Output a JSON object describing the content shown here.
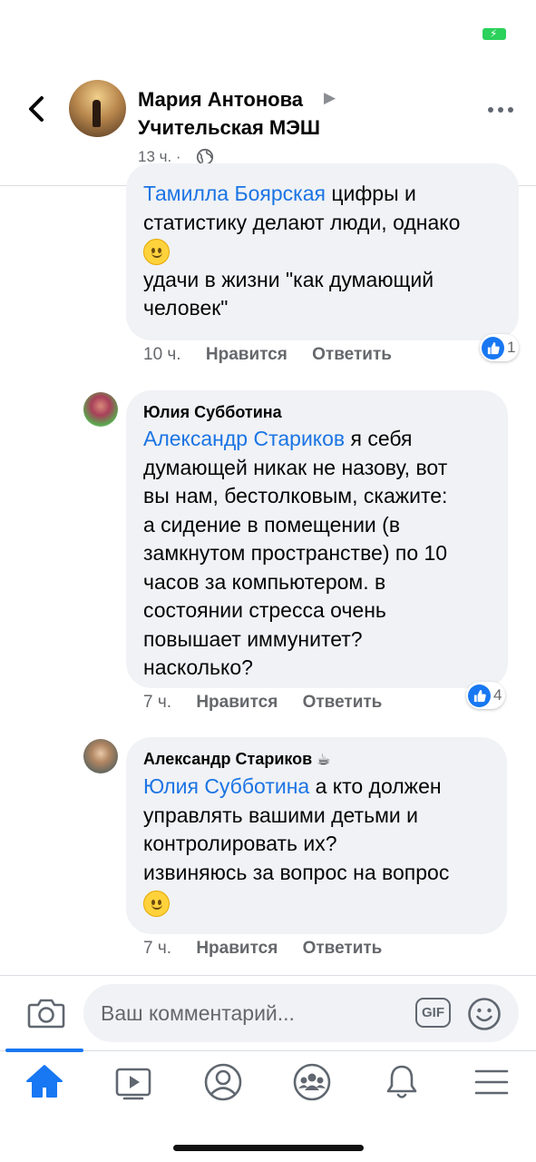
{
  "status_bar": {
    "battery_color": "#2bd15a",
    "icon": "charging-battery-icon"
  },
  "header": {
    "author": "Мария Антонова",
    "group": "Учительская МЭШ",
    "time": "13 ч. ·",
    "icons": [
      "back-chevron-icon",
      "globe-icon",
      "more-dots-icon",
      "triangle-right-icon"
    ]
  },
  "comments": [
    {
      "mention": "Тамилла Боярская",
      "line1": " цифры и",
      "line2": "статистику делают люди, однако",
      "line3": "удачи в  жизни \"как думающий",
      "line4": "человек\"",
      "time": "10 ч.",
      "like": "Нравится",
      "reply": "Ответить",
      "reactions": "1"
    },
    {
      "author": "Юлия Субботина",
      "mention": "Александр Стариков",
      "line1": " я себя",
      "line2": "думающей никак не назову, вот",
      "line3": "вы нам, бестолковым,  скажите:",
      "line4": "а сидение в помещении (в",
      "line5": "замкнутом пространстве) по 10",
      "line6": "часов за компьютером.  в",
      "line7": "состоянии стресса очень",
      "line8": "повышает иммунитет?",
      "line9": "насколько?",
      "time": "7 ч.",
      "like": "Нравится",
      "reply": "Ответить",
      "reactions": "4"
    },
    {
      "author": "Александр Стариков",
      "author_badge": "☕",
      "mention": "Юлия Субботина",
      "line1": " а кто должен",
      "line2": "управлять  вашими детьми и",
      "line3": "контролировать их?",
      "line4": "извиняюсь за вопрос на вопрос",
      "time": "7 ч.",
      "like": "Нравится",
      "reply": "Ответить"
    }
  ],
  "composer": {
    "placeholder": "Ваш комментарий...",
    "gif_label": "GIF",
    "icons": [
      "camera-icon",
      "gif-icon",
      "emoji-icon"
    ]
  },
  "tabbar": {
    "active_color": "#1877f2",
    "tabs": [
      "home-icon",
      "video-icon",
      "profile-icon",
      "groups-icon",
      "notifications-icon",
      "menu-icon"
    ]
  }
}
